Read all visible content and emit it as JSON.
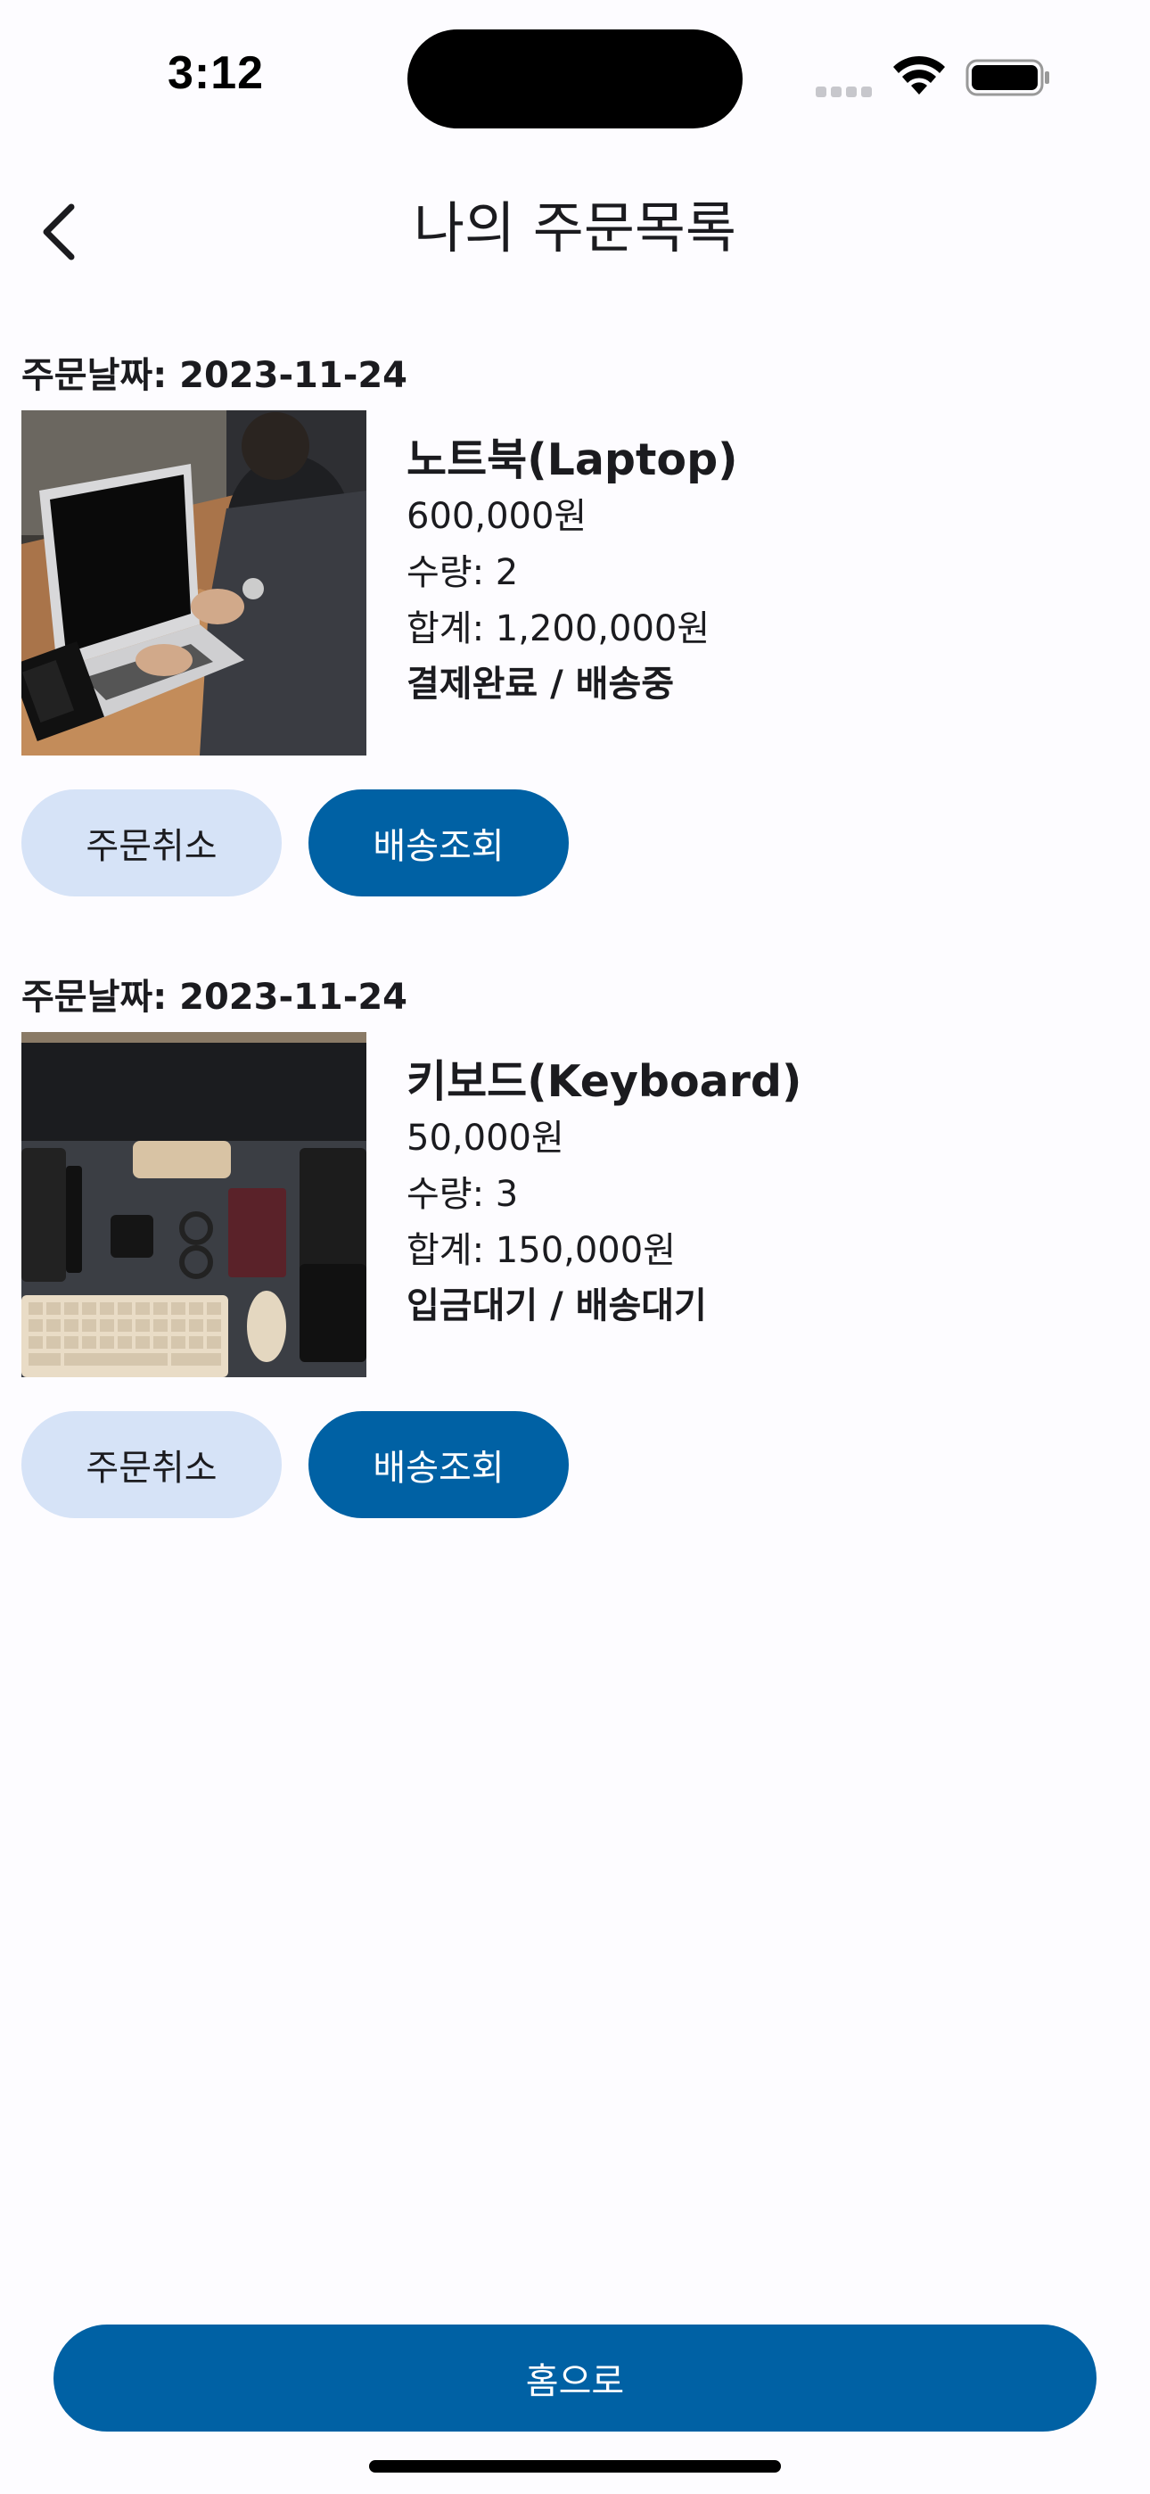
{
  "status_bar": {
    "time": "3:12",
    "icons": [
      "cellular-signal-icon",
      "wifi-icon",
      "battery-icon"
    ]
  },
  "header": {
    "title": "나의 주문목록",
    "back_icon": "chevron-left-icon"
  },
  "orders": [
    {
      "date_label": "주문날짜: 2023-11-24",
      "image": "laptop-photo",
      "name": "노트북(Laptop)",
      "price": "600,000원",
      "quantity": "수량: 2",
      "total": "합계: 1,200,000원",
      "status": "결제완료 / 배송중",
      "cancel_label": "주문취소",
      "track_label": "배송조회"
    },
    {
      "date_label": "주문날짜: 2023-11-24",
      "image": "keyboard-photo",
      "name": "키보드(Keyboard)",
      "price": "50,000원",
      "quantity": "수량: 3",
      "total": "합계: 150,000원",
      "status": "입금대기 / 배송대기",
      "cancel_label": "주문취소",
      "track_label": "배송조회"
    }
  ],
  "footer": {
    "home_label": "홈으로"
  },
  "colors": {
    "primary": "#0061a4",
    "secondary_container": "#d6e3f7",
    "background": "#fdfcff",
    "text": "#1b1b1f"
  }
}
